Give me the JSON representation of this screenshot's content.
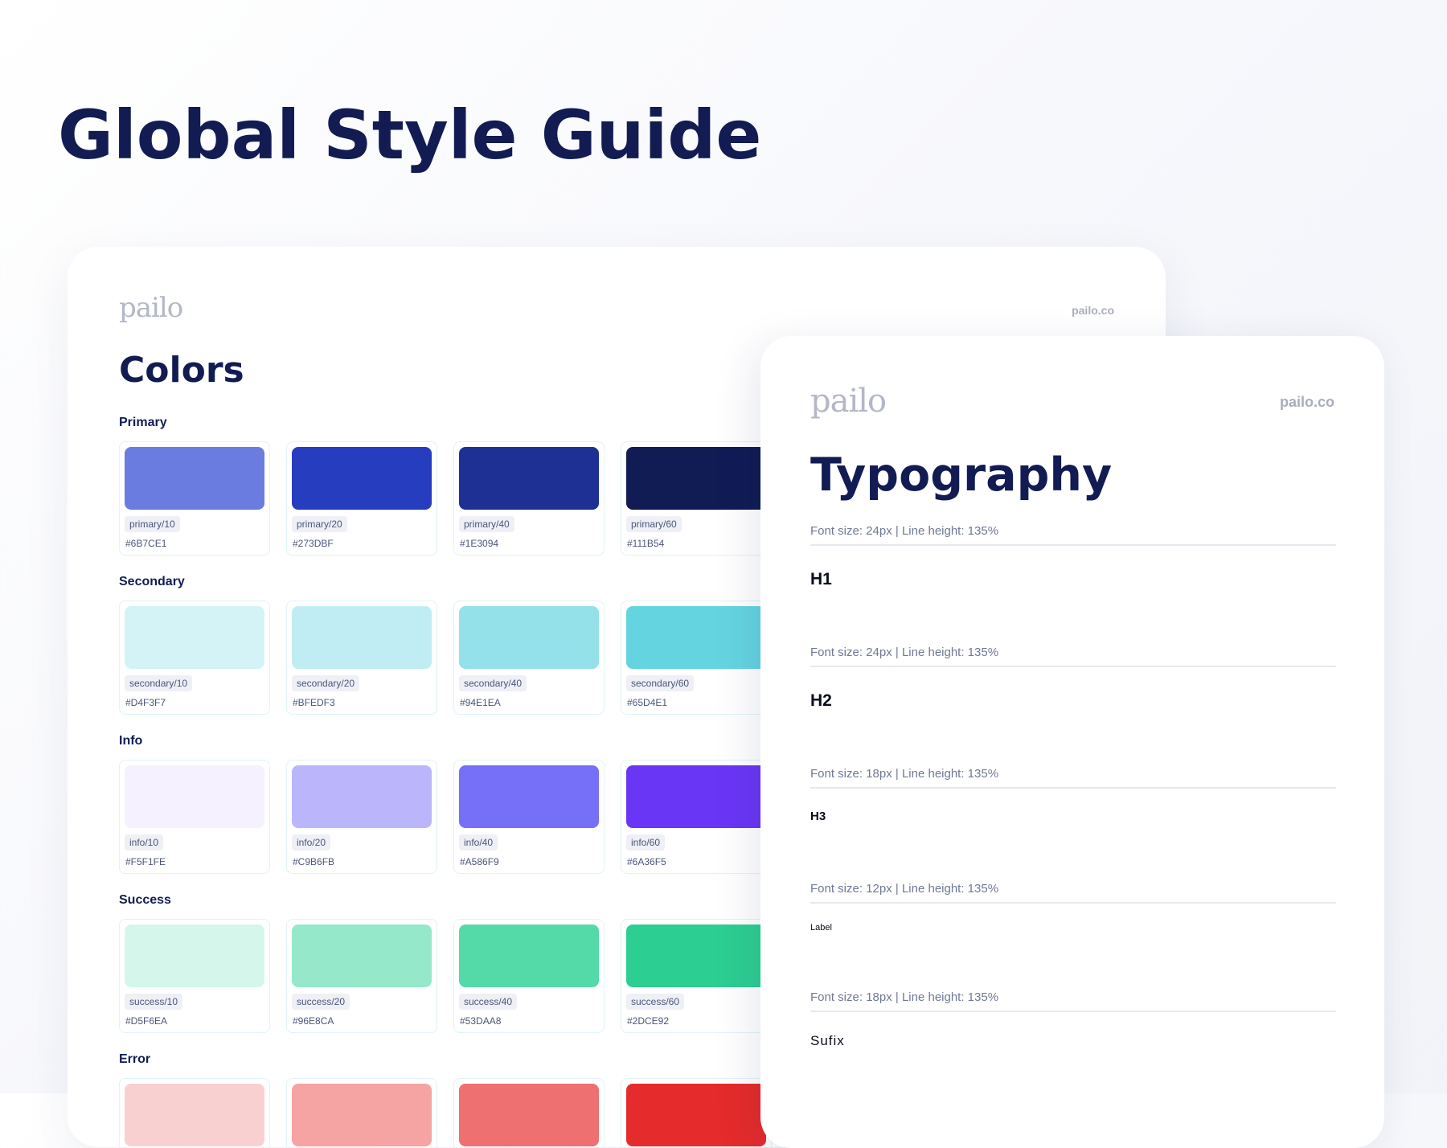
{
  "page": {
    "title": "Global Style Guide"
  },
  "colors_card": {
    "logo": "pailo",
    "site": "pailo.co",
    "title": "Colors",
    "groups": [
      {
        "label": "Primary",
        "swatches": [
          {
            "name": "primary/10",
            "hex": "#6B7CE1",
            "color": "#6B7CE1"
          },
          {
            "name": "primary/20",
            "hex": "#273DBF",
            "color": "#273DBF"
          },
          {
            "name": "primary/40",
            "hex": "#1E3094",
            "color": "#1E3094"
          },
          {
            "name": "primary/60",
            "hex": "#111B54",
            "color": "#111B54"
          }
        ]
      },
      {
        "label": "Secondary",
        "swatches": [
          {
            "name": "secondary/10",
            "hex": "#D4F3F7",
            "color": "#D4F3F7"
          },
          {
            "name": "secondary/20",
            "hex": "#BFEDF3",
            "color": "#BFEDF3"
          },
          {
            "name": "secondary/40",
            "hex": "#94E1EA",
            "color": "#94E1EA"
          },
          {
            "name": "secondary/60",
            "hex": "#65D4E1",
            "color": "#65D4E1"
          }
        ]
      },
      {
        "label": "Info",
        "swatches": [
          {
            "name": "info/10",
            "hex": "#F5F1FE",
            "color": "#F5F1FE"
          },
          {
            "name": "info/20",
            "hex": "#C9B6FB",
            "color": "#BBB6FB"
          },
          {
            "name": "info/40",
            "hex": "#A586F9",
            "color": "#7670F9"
          },
          {
            "name": "info/60",
            "hex": "#6A36F5",
            "color": "#6A36F5"
          }
        ]
      },
      {
        "label": "Success",
        "swatches": [
          {
            "name": "success/10",
            "hex": "#D5F6EA",
            "color": "#D5F6EA"
          },
          {
            "name": "success/20",
            "hex": "#96E8CA",
            "color": "#96E8CA"
          },
          {
            "name": "success/40",
            "hex": "#53DAA8",
            "color": "#53DAA8"
          },
          {
            "name": "success/60",
            "hex": "#2DCE92",
            "color": "#2DCE92"
          }
        ]
      },
      {
        "label": "Error",
        "swatches": [
          {
            "name": "",
            "hex": "",
            "color": "#F9D0D0"
          },
          {
            "name": "",
            "hex": "",
            "color": "#F5A3A3"
          },
          {
            "name": "",
            "hex": "",
            "color": "#EF7070"
          },
          {
            "name": "",
            "hex": "",
            "color": "#E52B2B"
          }
        ]
      }
    ]
  },
  "type_card": {
    "logo": "pailo",
    "site": "pailo.co",
    "title": "Typography",
    "rows": [
      {
        "meta": "Font size: 24px | Line height: 135%",
        "sample": "H1"
      },
      {
        "meta": "Font size: 24px | Line height: 135%",
        "sample": "H2"
      },
      {
        "meta": "Font size: 18px | Line height: 135%",
        "sample": "H3"
      },
      {
        "meta": "Font size: 12px | Line height: 135%",
        "sample": "Label"
      },
      {
        "meta": "Font size: 18px | Line height: 135%",
        "sample": "Sufix"
      }
    ]
  }
}
